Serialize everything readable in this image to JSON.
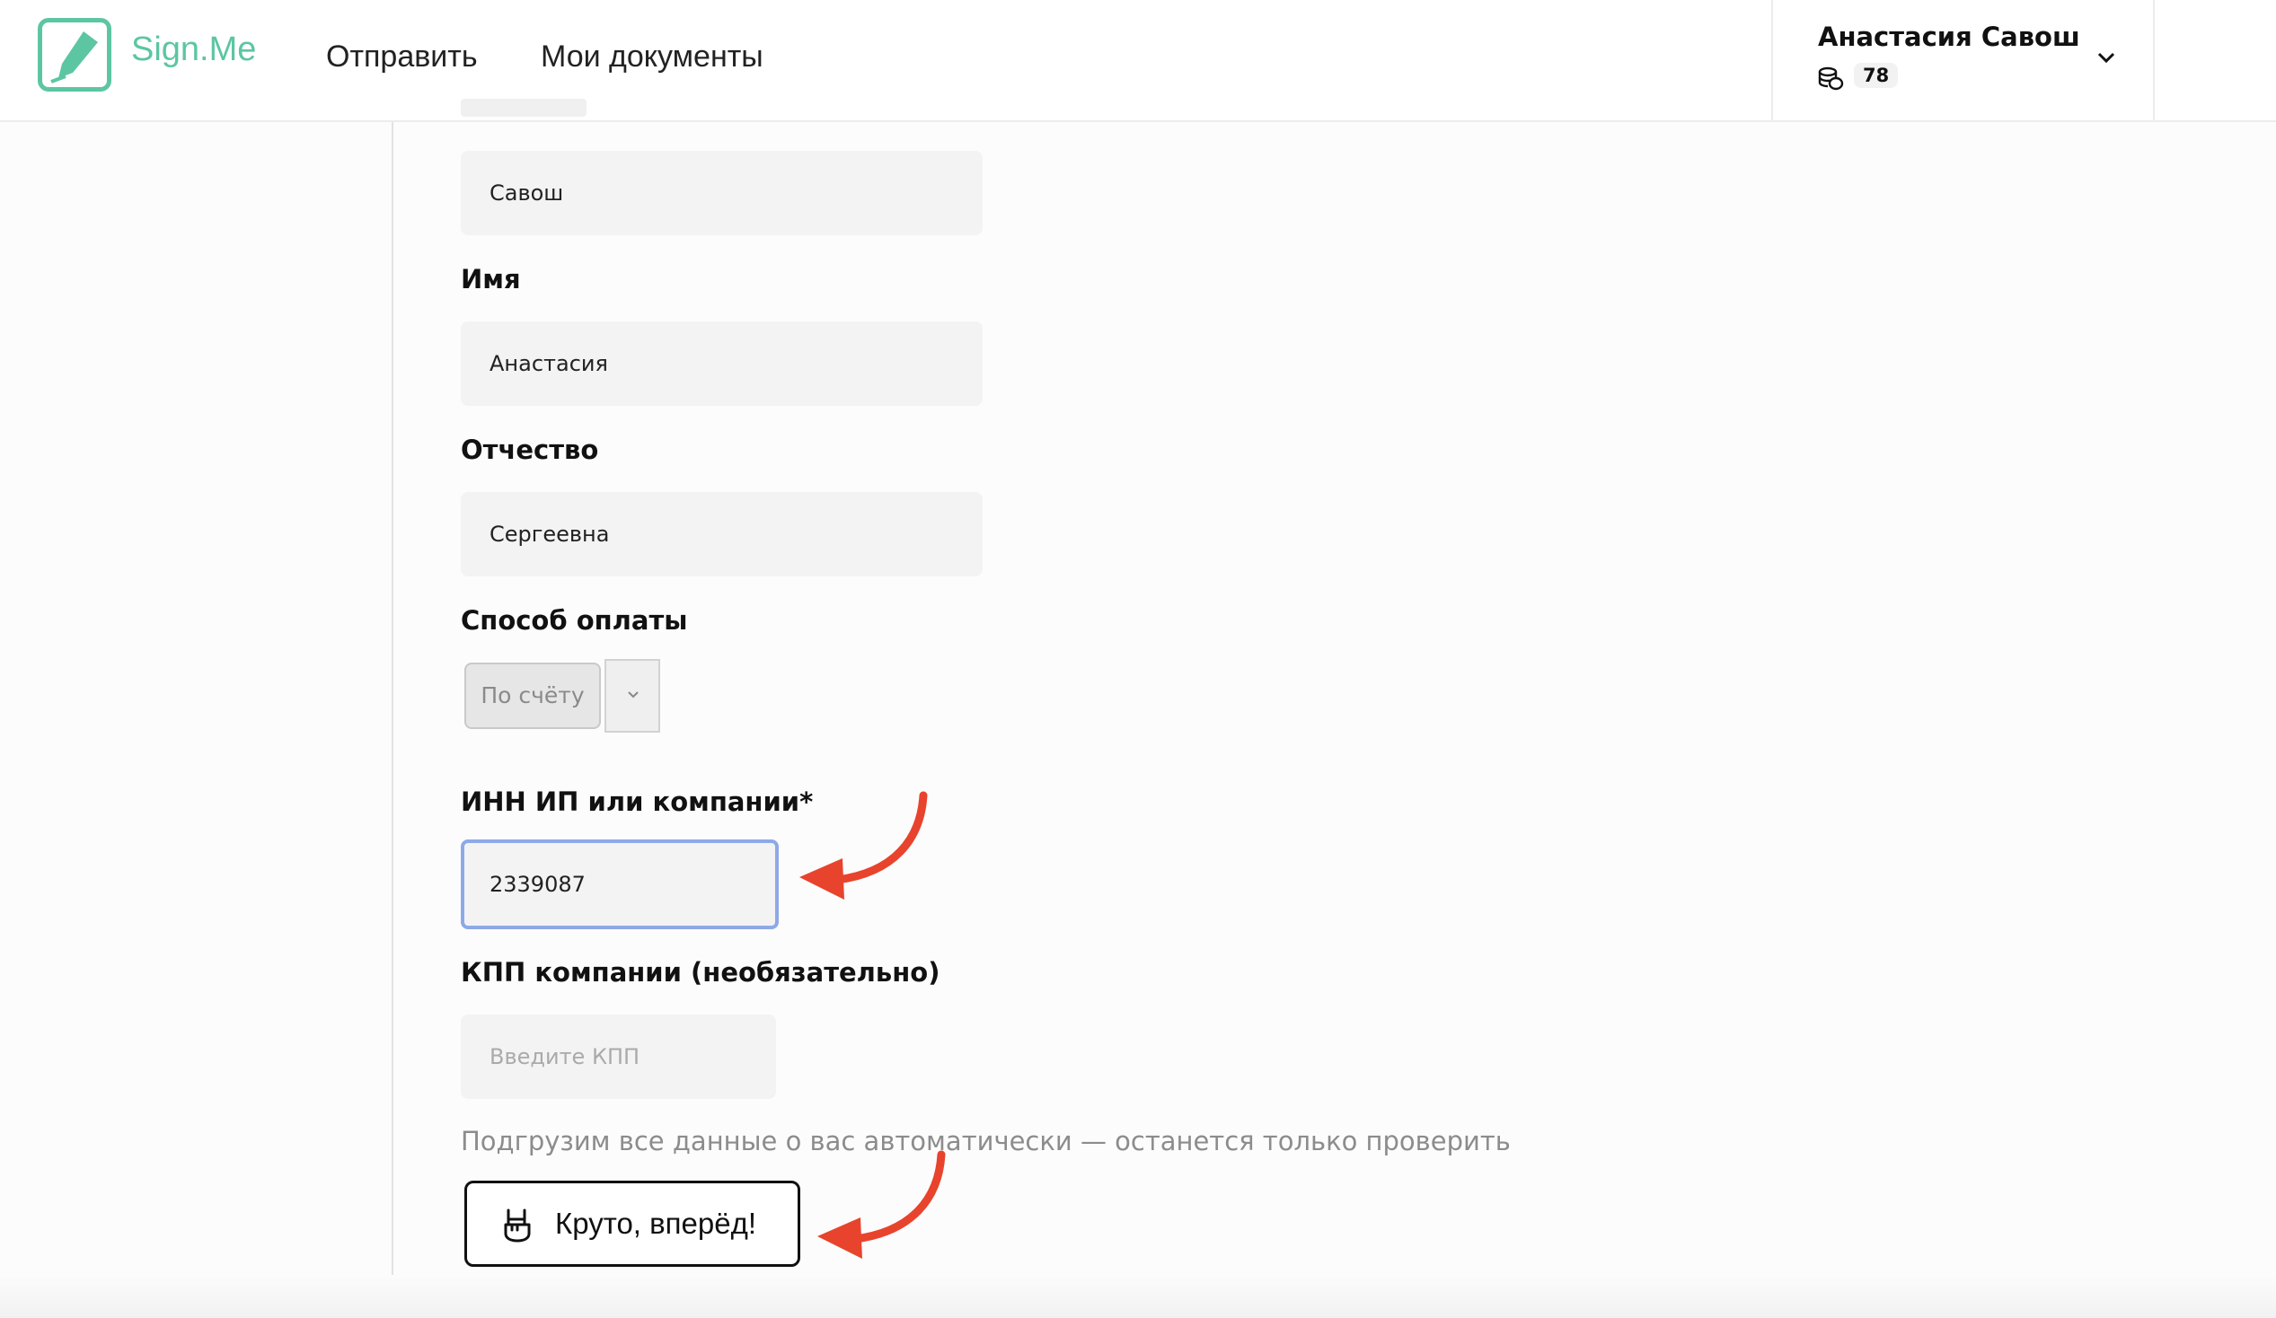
{
  "header": {
    "logo_text": "Sign.Me",
    "nav": {
      "send": "Отправить",
      "documents": "Мои документы"
    },
    "user": {
      "name": "Анастасия Савош",
      "coins": "78"
    }
  },
  "form": {
    "last_name": {
      "value": "Савош"
    },
    "first_name": {
      "label": "Имя",
      "value": "Анастасия"
    },
    "patronymic": {
      "label": "Отчество",
      "value": "Сергеевна"
    },
    "payment": {
      "label": "Способ оплаты",
      "selected": "По счёту"
    },
    "inn": {
      "label": "ИНН ИП или компании*",
      "value": "2339087"
    },
    "kpp": {
      "label": "КПП компании (необязательно)",
      "placeholder": "Введите КПП"
    },
    "hint": "Подгрузим все данные о вас автоматически — останется только проверить",
    "submit_label": "Круто, вперёд!"
  },
  "colors": {
    "brand": "#5cc6a2",
    "focus_border": "#8ea9e8",
    "annotation_arrow": "#e8432c"
  },
  "icons": {
    "logo": "pen-in-square-icon",
    "coins": "coins-icon",
    "user_menu": "chevron-down-icon",
    "select": "chevron-down-icon",
    "submit": "rock-hand-icon"
  }
}
